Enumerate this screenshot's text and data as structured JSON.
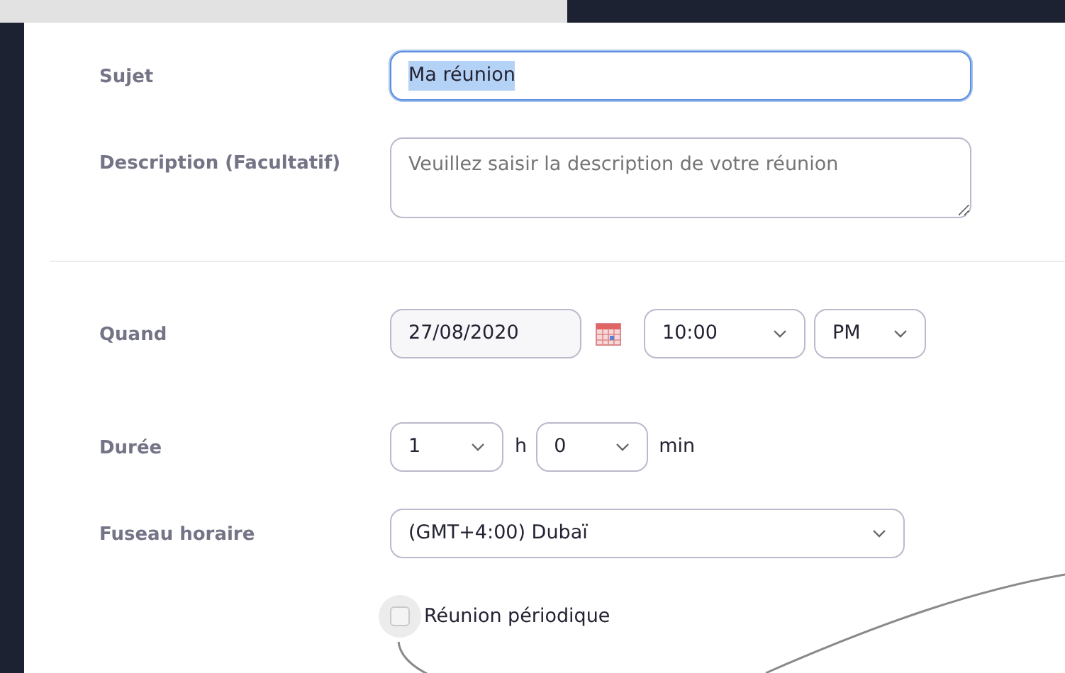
{
  "subject": {
    "label": "Sujet",
    "value": "Ma réunion",
    "focused": true
  },
  "description": {
    "label": "Description (Facultatif)",
    "placeholder": "Veuillez saisir la description de votre réunion"
  },
  "when": {
    "label": "Quand",
    "date": "27/08/2020",
    "time": "10:00",
    "period": "PM"
  },
  "duration": {
    "label": "Durée",
    "hours": "1",
    "hours_unit": "h",
    "minutes": "0",
    "minutes_unit": "min"
  },
  "timezone": {
    "label": "Fuseau horaire",
    "value": "(GMT+4:00) Dubaï"
  },
  "recurring": {
    "label": "Réunion périodique",
    "checked": false
  }
}
